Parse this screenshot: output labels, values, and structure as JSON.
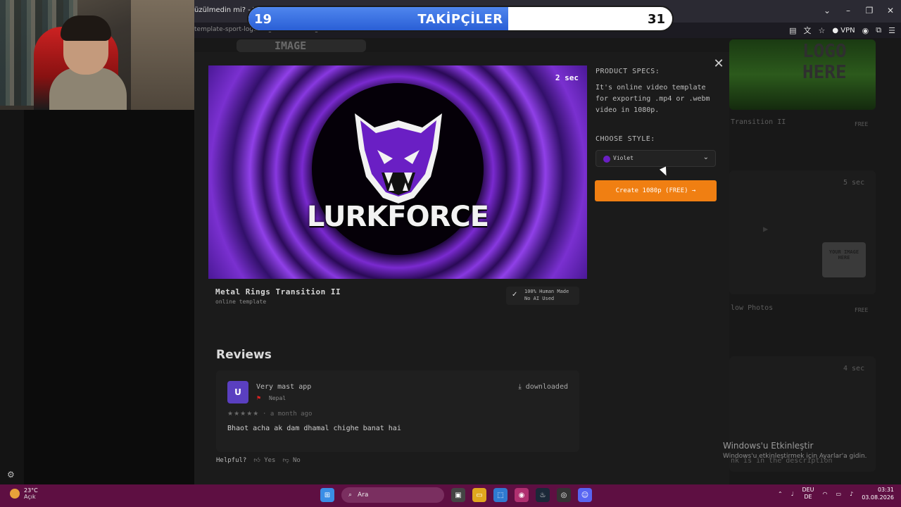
{
  "browser": {
    "tab_title": "üzülmedin mi? - Yo",
    "url": "template-sport-logo-rings-stadium-target-transition-ii",
    "vpn": "VPN"
  },
  "followers_overlay": {
    "current": "19",
    "label": "TAKİPÇİLER",
    "goal": "31",
    "progress": 0.6129
  },
  "modal": {
    "duration": "2 sec",
    "preview_brand": "LURKFORCE",
    "specs_label": "PRODUCT SPECS:",
    "specs_text": "It's online video template for exporting .mp4 or .webm video in 1080p.",
    "style_label": "CHOOSE STYLE:",
    "style_value": "Violet",
    "style_color": "#6a1fc4",
    "create_button": "Create 1080p (FREE) →",
    "template_title": "Metal Rings Transition II",
    "template_subtitle": "online template",
    "human_badge_line1": "100% Human Made",
    "human_badge_line2": "No AI Used"
  },
  "reviews": {
    "heading": "Reviews",
    "items": [
      {
        "avatar_letter": "U",
        "name": "Very mast app",
        "country": "Nepal",
        "status": "downloaded",
        "stars": "★★★★★",
        "when": "· a month ago",
        "body": "Bhaot acha ak dam dhamal chighe banat hai"
      }
    ],
    "helpful_label": "Helpful?",
    "yes_label": "Yes",
    "no_label": "No"
  },
  "background": {
    "bg_image_label": "IMAGE",
    "bg_logo_label": "LOGO HERE",
    "bg_transition": "Transition II",
    "bg_free_1": "FREE",
    "bg_5sec": "5 sec",
    "bg_your_image": "YOUR IMAGE HERE",
    "bg_photos": "low Photos",
    "bg_free_2": "FREE",
    "bg_4sec": "4 sec",
    "bg_description": "nk is in the description"
  },
  "windows_activate": {
    "title": "Windows'u Etkinleştir",
    "subtitle": "Windows'u etkinleştirmek için Ayarlar'a gidin."
  },
  "taskbar": {
    "temperature": "23°C",
    "condition": "Açık",
    "search_placeholder": "Ara",
    "lang_1": "DEU",
    "lang_2": "DE",
    "time": "03:31",
    "date": "03.08.2026"
  },
  "colors": {
    "accent_orange": "#f07f12",
    "taskbar": "#5e0f42",
    "follow_blue": "#2a5fd6"
  }
}
